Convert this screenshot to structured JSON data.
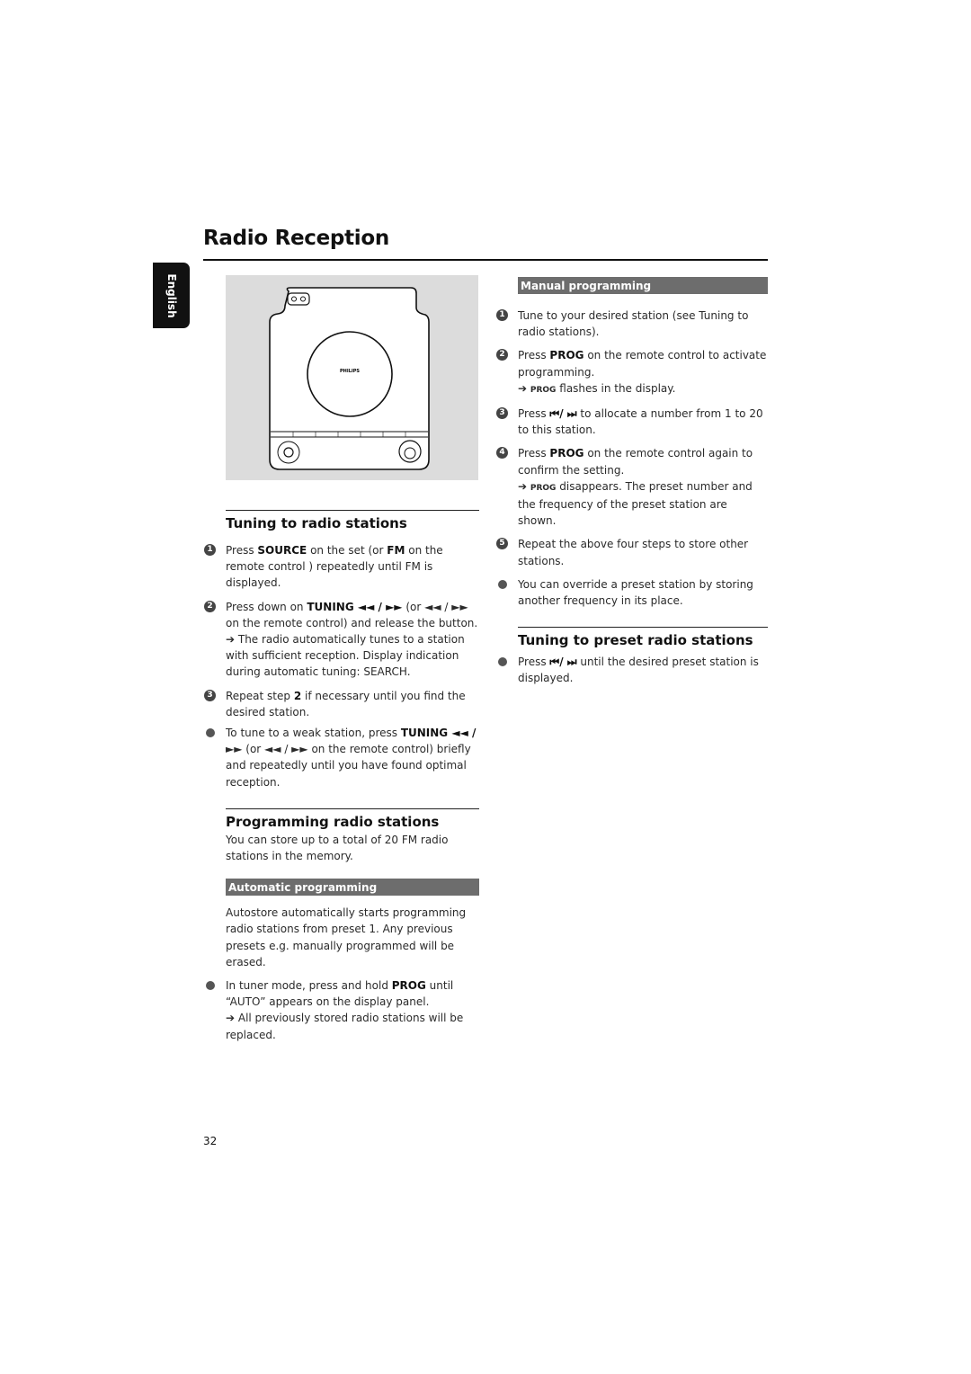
{
  "page": {
    "title": "Radio Reception",
    "language_tab": "English",
    "page_number": "32"
  },
  "figure": {
    "brand": "PHILIPS",
    "description": "Front view of stereo unit with CD lid"
  },
  "tuning": {
    "heading": "Tuning to radio stations",
    "steps": [
      {
        "marker": "1",
        "pre": "Press ",
        "b1": "SOURCE",
        "mid": " on the set (or ",
        "b2": "FM",
        "post": " on the remote control ) repeatedly until FM is displayed."
      },
      {
        "marker": "2",
        "pre": "Press down on ",
        "b1": "TUNING ◄◄ / ►►",
        "post": "  (or ◄◄ / ►► on the remote control) and release the button.",
        "note": "➔ The radio automatically tunes to a station with sufficient reception. Display indication during automatic tuning: SEARCH."
      },
      {
        "marker": "3",
        "pre": "Repeat step ",
        "b1": "2",
        "post": " if necessary until you find the desired station."
      }
    ],
    "bullet": {
      "pre": "To tune to a weak station, press ",
      "b1": "TUNING ◄◄ /",
      "post": " ►►  (or ◄◄ / ►► on the remote control) briefly and repeatedly until you have found optimal reception."
    }
  },
  "programming": {
    "heading": "Programming radio stations",
    "intro": "You can store up to a total of 20 FM radio stations  in the memory.",
    "automatic": {
      "heading": "Automatic programming",
      "text": "Autostore automatically starts programming radio stations from preset 1. Any previous presets e.g. manually programmed will be erased.",
      "bullet_pre": "In tuner mode, press and hold ",
      "bullet_b": "PROG",
      "bullet_post": " until “AUTO” appears on the display panel.",
      "note": "➔ All previously stored radio stations will be replaced."
    }
  },
  "manual": {
    "heading": "Manual programming",
    "steps": [
      {
        "marker": "1",
        "text": "Tune to your desired station (see Tuning to radio stations)."
      },
      {
        "marker": "2",
        "pre": "Press ",
        "b1": "PROG",
        "post": " on the remote control to activate programming.",
        "note_arrow": "➔ ",
        "note_sc": "PROG",
        "note_post": " flashes in the display."
      },
      {
        "marker": "3",
        "pre": "Press ",
        "b1": "⏮/ ⏭",
        "post": " to allocate a number from 1 to 20 to this station."
      },
      {
        "marker": "4",
        "pre": "Press ",
        "b1": "PROG",
        "post": " on the remote control again to confirm the setting.",
        "note_arrow": "➔ ",
        "note_sc": "PROG",
        "note_post": " disappears. The preset number and the frequency of the preset station are shown."
      },
      {
        "marker": "5",
        "text": "Repeat the above four steps to store other stations."
      }
    ],
    "bullet": "You can override a preset station by storing another frequency in its place."
  },
  "preset": {
    "heading": "Tuning to preset radio stations",
    "bullet_pre": "Press ",
    "bullet_b": "⏮/ ⏭",
    "bullet_post": " until the desired preset station is displayed."
  }
}
